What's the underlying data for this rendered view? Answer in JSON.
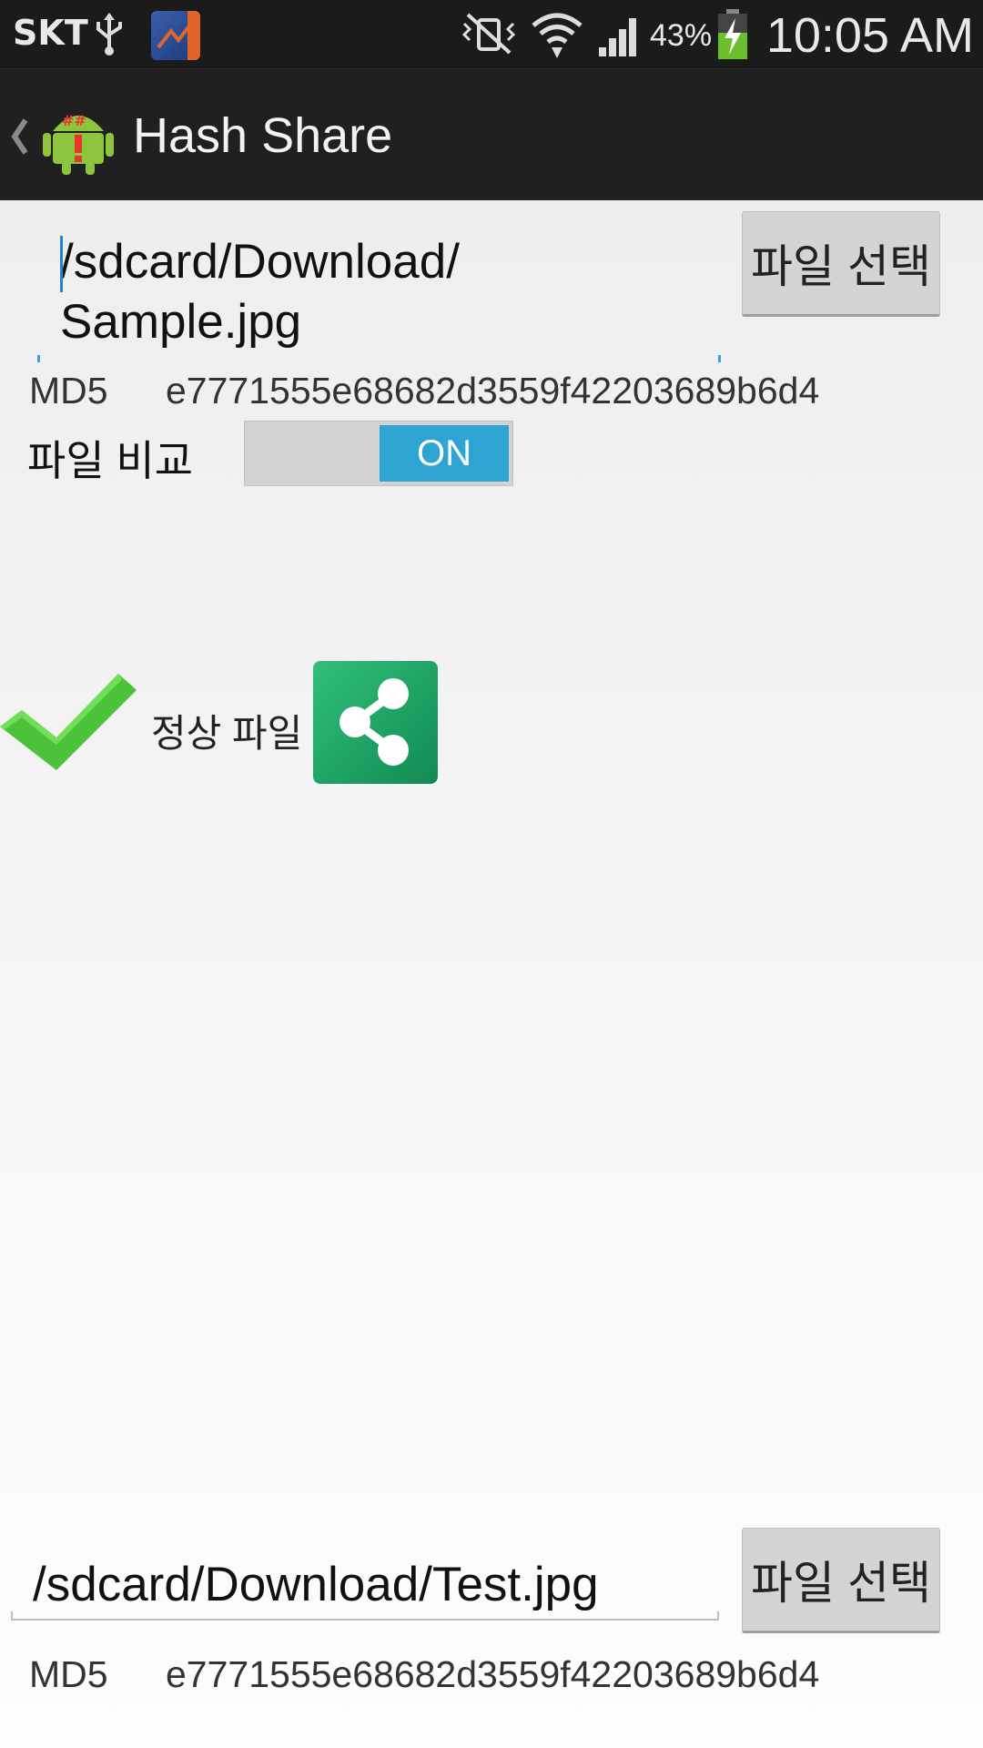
{
  "status_bar": {
    "carrier": "SKT",
    "battery_percent": "43%",
    "time": "10:05 AM",
    "icons": [
      "usb-icon",
      "notification-app-icon",
      "vibrate-mute-icon",
      "wifi-icon",
      "signal-icon",
      "battery-charging-icon"
    ]
  },
  "action_bar": {
    "title": "Hash Share",
    "icons": [
      "up-chevron-icon",
      "android-hash-logo-icon"
    ]
  },
  "file1": {
    "path_line1": "/sdcard/Download/",
    "path_line2": "Sample.jpg",
    "select_button": "파일 선택",
    "md5_label": "MD5",
    "md5_value": "e7771555e68682d3559f42203689b6d4"
  },
  "compare": {
    "label": "파일 비교",
    "toggle_state": "ON"
  },
  "result": {
    "text": "정상 파일",
    "icons": [
      "checkmark-icon",
      "share-icon"
    ],
    "accent_color": "#2fc07a"
  },
  "file2": {
    "path": "/sdcard/Download/Test.jpg",
    "select_button": "파일 선택",
    "md5_label": "MD5",
    "md5_value": "e7771555e68682d3559f42203689b6d4"
  }
}
